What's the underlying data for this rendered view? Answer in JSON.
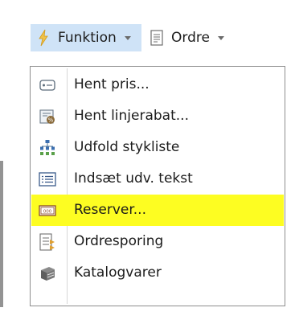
{
  "toolbar": {
    "funktion": {
      "label": "Funktion",
      "icon": "lightning-icon"
    },
    "ordre": {
      "label": "Ordre",
      "icon": "document-icon"
    }
  },
  "menu": {
    "items": [
      {
        "label": "Hent pris...",
        "icon": "price-tag-icon",
        "highlighted": false
      },
      {
        "label": "Hent linjerabat...",
        "icon": "discount-icon",
        "highlighted": false
      },
      {
        "label": "Udfold stykliste",
        "icon": "hierarchy-icon",
        "highlighted": false
      },
      {
        "label": "Indsæt udv. tekst",
        "icon": "text-list-icon",
        "highlighted": false
      },
      {
        "label": "Reserver...",
        "icon": "reserve-icon",
        "highlighted": true
      },
      {
        "label": "Ordresporing",
        "icon": "order-tracking-icon",
        "highlighted": false
      },
      {
        "label": "Katalogvarer",
        "icon": "catalog-icon",
        "highlighted": false
      }
    ]
  },
  "colors": {
    "toolbar_active_bg": "#cfe3f7",
    "highlight": "#fdfd22",
    "menu_border": "#8e8e8e"
  }
}
